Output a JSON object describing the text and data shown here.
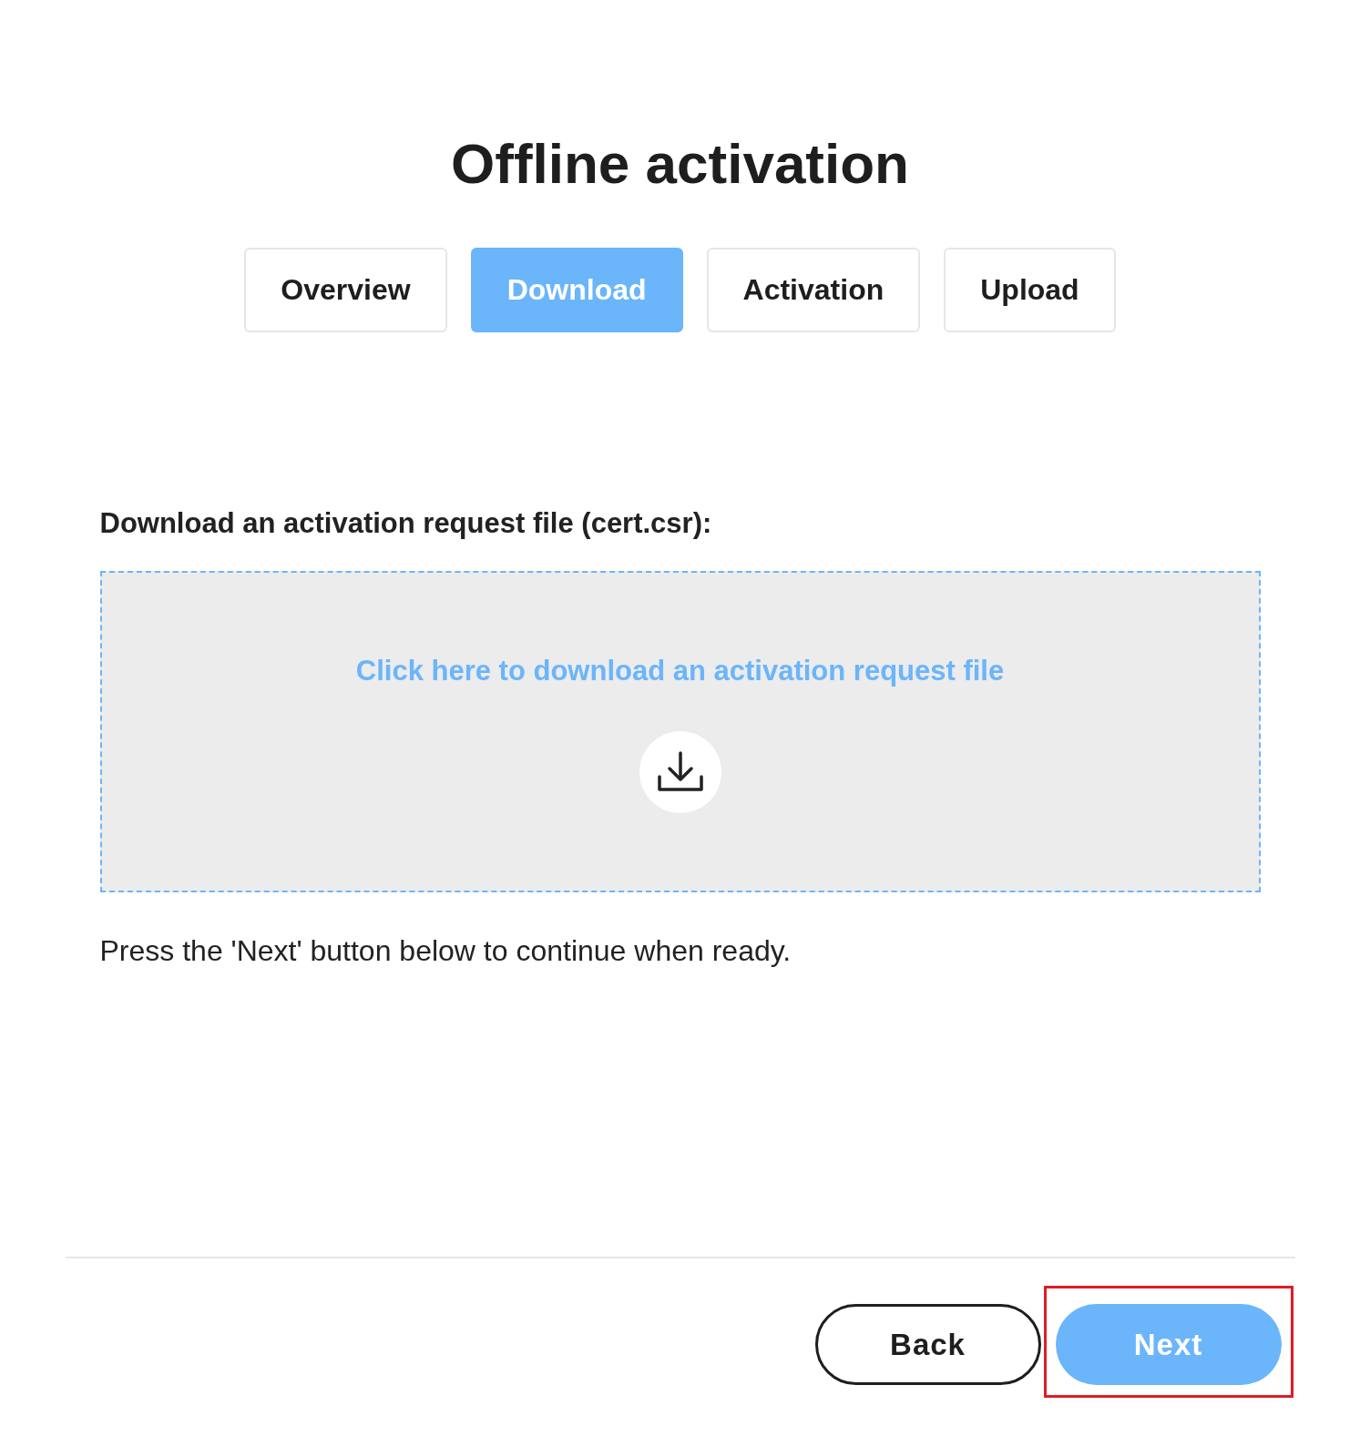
{
  "title": "Offline activation",
  "tabs": [
    {
      "label": "Overview",
      "selected": false
    },
    {
      "label": "Download",
      "selected": true
    },
    {
      "label": "Activation",
      "selected": false
    },
    {
      "label": "Upload",
      "selected": false
    }
  ],
  "section_label": "Download an activation request file (cert.csr):",
  "download_area": {
    "link": "Click here to download an activation request file"
  },
  "instruction": "Press the 'Next' button below to continue when ready.",
  "buttons": [
    {
      "label": "Back",
      "kind": "secondary",
      "highlighted": false
    },
    {
      "label": "Next",
      "kind": "primary",
      "highlighted": true
    }
  ]
}
